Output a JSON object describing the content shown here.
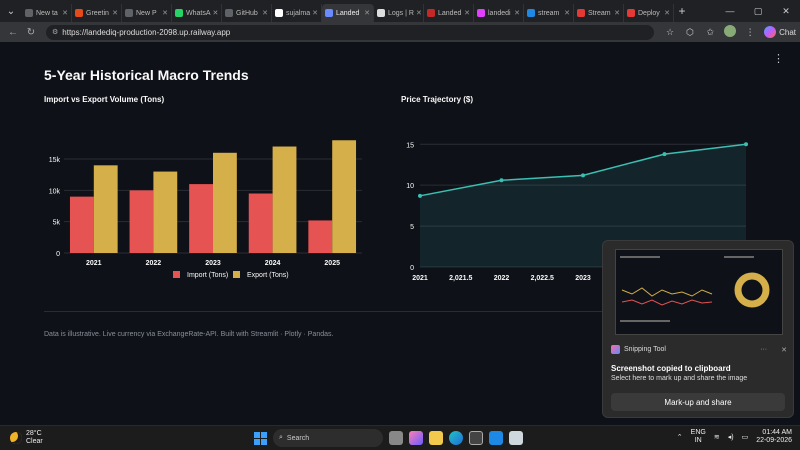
{
  "browser": {
    "tabs": [
      {
        "label": "New ta",
        "color": "#5f6368"
      },
      {
        "label": "Greetin",
        "color": "#e64a19"
      },
      {
        "label": "New P",
        "color": "#5f6368"
      },
      {
        "label": "WhatsA",
        "color": "#25d366"
      },
      {
        "label": "GitHub",
        "color": "#5f6368"
      },
      {
        "label": "sujalma",
        "color": "#ffffff"
      },
      {
        "label": "Landed",
        "color": "#6a8cff"
      },
      {
        "label": "Logs | R",
        "color": "#dddddd"
      },
      {
        "label": "Landed",
        "color": "#c62828"
      },
      {
        "label": "landedi",
        "color": "#e040fb"
      },
      {
        "label": "stream",
        "color": "#1e88e5"
      },
      {
        "label": "Stream",
        "color": "#e53935"
      },
      {
        "label": "Deploy",
        "color": "#e53935"
      }
    ],
    "active_tab_index": 6,
    "url": "https://landediq-production-2098.up.railway.app",
    "chat_label": "Chat"
  },
  "page": {
    "title": "5-Year Historical Macro Trends",
    "footnote": "Data is illustrative. Live currency via ExchangeRate-API. Built with Streamlit · Plotly · Pandas."
  },
  "chart_data": [
    {
      "type": "bar",
      "title": "Import vs Export Volume (Tons)",
      "categories": [
        "2021",
        "2022",
        "2023",
        "2024",
        "2025"
      ],
      "series": [
        {
          "name": "Import (Tons)",
          "color": "#e55353",
          "values": [
            9000,
            10000,
            11000,
            9500,
            5200
          ]
        },
        {
          "name": "Export (Tons)",
          "color": "#d4af4a",
          "values": [
            14000,
            13000,
            16000,
            17000,
            18000
          ]
        }
      ],
      "yticks": [
        "0",
        "5k",
        "10k",
        "15k"
      ],
      "ylim": [
        0,
        19000
      ],
      "legend": "bottom"
    },
    {
      "type": "area",
      "title": "Price Trajectory ($)",
      "x": [
        2021,
        2022,
        2023,
        2024,
        2025
      ],
      "values": [
        8.7,
        10.6,
        11.2,
        13.8,
        15.0
      ],
      "xticks": [
        "2021",
        "2,021.5",
        "2022",
        "2,022.5",
        "2023"
      ],
      "yticks": [
        "0",
        "5",
        "10",
        "15"
      ],
      "ylim": [
        0,
        16.5
      ],
      "color": "#3bbfb2"
    }
  ],
  "toast": {
    "app": "Snipping Tool",
    "message": "Screenshot copied to clipboard",
    "detail": "Select here to mark up and share the image",
    "button": "Mark-up and share"
  },
  "taskbar": {
    "temp": "28°C",
    "condition": "Clear",
    "search": "Search",
    "lang1": "ENG",
    "lang2": "IN",
    "time": "01:44 AM",
    "date": "22-09-2026"
  }
}
